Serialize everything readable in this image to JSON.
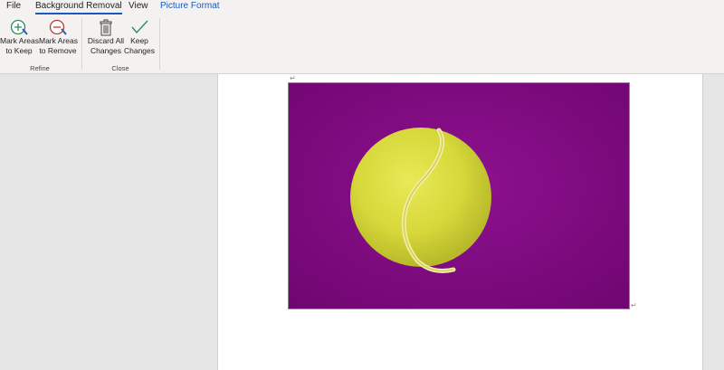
{
  "tabs": [
    {
      "label": "File"
    },
    {
      "label": "Background Removal",
      "active": true
    },
    {
      "label": "View"
    },
    {
      "label": "Picture Format",
      "contextual": true
    }
  ],
  "ribbon": {
    "refine": {
      "label": "Refine",
      "mark_keep": {
        "line1": "Mark Areas",
        "line2": "to Keep",
        "icon": "plus-pen-icon"
      },
      "mark_remove": {
        "line1": "Mark Areas",
        "line2": "to Remove",
        "icon": "minus-pen-icon"
      }
    },
    "close": {
      "label": "Close",
      "discard": {
        "line1": "Discard All",
        "line2": "Changes",
        "icon": "trash-icon"
      },
      "keep": {
        "line1": "Keep",
        "line2": "Changes",
        "icon": "checkmark-icon"
      }
    }
  },
  "document": {
    "paragraph_mark": "↵"
  },
  "colors": {
    "accent": "#185abd",
    "removal_overlay": "#8a0a8c",
    "ball": "#dcdc3c"
  }
}
